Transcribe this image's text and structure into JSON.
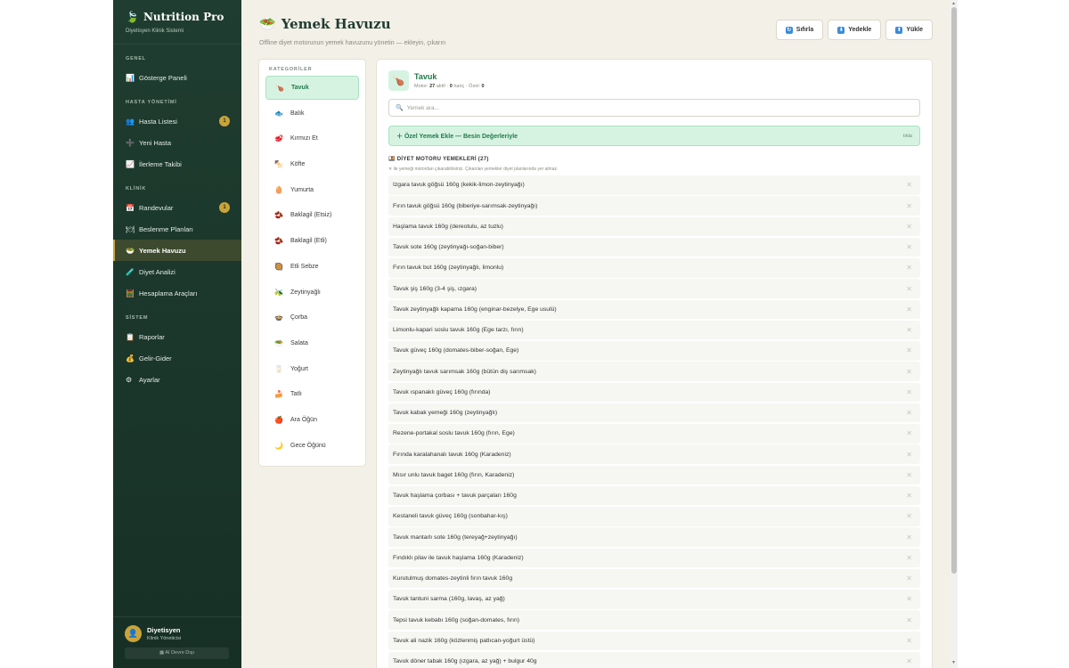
{
  "sidebar": {
    "brand_icon": "🍃",
    "title": "Nutrition Pro",
    "subtitle": "Diyetisyen Klinik Sistemi",
    "sections": [
      {
        "label": "GENEL",
        "items": [
          {
            "icon": "📊",
            "label": "Gösterge Paneli"
          }
        ]
      },
      {
        "label": "HASTA YÖNETİMİ",
        "items": [
          {
            "icon": "👥",
            "label": "Hasta Listesi",
            "badge": "1"
          },
          {
            "icon": "➕",
            "label": "Yeni Hasta"
          },
          {
            "icon": "📈",
            "label": "İlerleme Takibi"
          }
        ]
      },
      {
        "label": "KLİNİK",
        "items": [
          {
            "icon": "📅",
            "label": "Randevular",
            "badge": "1"
          },
          {
            "icon": "🍽",
            "label": "Beslenme Planları"
          },
          {
            "icon": "🥗",
            "label": "Yemek Havuzu",
            "active": true
          },
          {
            "icon": "🧪",
            "label": "Diyet Analizi"
          },
          {
            "icon": "🧮",
            "label": "Hesaplama Araçları"
          }
        ]
      },
      {
        "label": "SİSTEM",
        "items": [
          {
            "icon": "📋",
            "label": "Raporlar"
          },
          {
            "icon": "💰",
            "label": "Gelir-Gider"
          },
          {
            "icon": "⚙",
            "label": "Ayarlar"
          }
        ]
      }
    ],
    "user": {
      "name": "Diyetisyen",
      "role": "Klinik Yöneticisi",
      "ai_button": "AI Devre Dışı"
    }
  },
  "header": {
    "icon": "🥗",
    "title": "Yemek Havuzu",
    "subtitle": "Offline diyet motorunun yemek havuzunu yönetin — ekleyin, çıkarın",
    "buttons": [
      {
        "icon": "↻",
        "label": "Sıfırla"
      },
      {
        "icon": "⬇",
        "label": "Yedekle"
      },
      {
        "icon": "⬆",
        "label": "Yükle"
      }
    ]
  },
  "categories": {
    "title": "KATEGORİLER",
    "items": [
      {
        "icon": "🍗",
        "label": "Tavuk",
        "active": true
      },
      {
        "icon": "🐟",
        "label": "Balık"
      },
      {
        "icon": "🥩",
        "label": "Kırmızı Et"
      },
      {
        "icon": "🍢",
        "label": "Köfte"
      },
      {
        "icon": "🥚",
        "label": "Yumurta"
      },
      {
        "icon": "🫘",
        "label": "Baklagil (Etsiz)"
      },
      {
        "icon": "🫘",
        "label": "Baklagil (Etli)"
      },
      {
        "icon": "🥘",
        "label": "Etli Sebze"
      },
      {
        "icon": "🫒",
        "label": "Zeytinyağlı"
      },
      {
        "icon": "🍲",
        "label": "Çorba"
      },
      {
        "icon": "🥗",
        "label": "Salata"
      },
      {
        "icon": "🥛",
        "label": "Yoğurt"
      },
      {
        "icon": "🍰",
        "label": "Tatlı"
      },
      {
        "icon": "🍎",
        "label": "Ara Öğün"
      },
      {
        "icon": "🌙",
        "label": "Gece Öğünü"
      }
    ]
  },
  "main": {
    "icon": "🍗",
    "title": "Tavuk",
    "stats_prefix": "Motor:",
    "stats_active": "27",
    "stats_active_label": "aktif ·",
    "stats_excluded": "0",
    "stats_excluded_label": "hariç · Özel:",
    "stats_custom": "0",
    "search_placeholder": "Yemek ara...",
    "add_label": "Özel Yemek Ekle — Besin Değerleriyle",
    "add_hint": "tıkla",
    "motor_title": "DİYET MOTORU YEMEKLERİ (27)",
    "motor_note": "✕ ile yemeği motordan çıkarabilirsiniz. Çıkarılan yemekler diyet planlarında yer almaz.",
    "meals": [
      "Izgara tavuk göğsü 160g (kekik-limon-zeytinyağı)",
      "Fırın tavuk göğsü 160g (biberiye-sarımsak-zeytinyağı)",
      "Haşlama tavuk 160g (dereotulu, az tuzlu)",
      "Tavuk sote 160g (zeytinyağı-soğan-biber)",
      "Fırın tavuk but 160g (zeytinyağlı, limonlu)",
      "Tavuk şiş 160g (3-4 şiş, ızgara)",
      "Tavuk zeytinyağlı kapama 160g (enginar-bezelye, Ege usulü)",
      "Limonlu-kapari soslu tavuk 160g (Ege tarzı, fırın)",
      "Tavuk güveç 160g (domates-biber-soğan, Ege)",
      "Zeytinyağlı tavuk sarımsak 160g (bütün diş sarımsak)",
      "Tavuk ıspanaklı güveç 160g (fırında)",
      "Tavuk kabak yemeği 160g (zeytinyağlı)",
      "Rezene-portakal soslu tavuk 160g (fırın, Ege)",
      "Fırında karalahanalı tavuk 160g (Karadeniz)",
      "Mısır unlu tavuk baget 160g (fırın, Karadeniz)",
      "Tavuk haşlama çorbası + tavuk parçaları 160g",
      "Kestaneli tavuk güveç 160g (sonbahar-kış)",
      "Tavuk mantarlı sote 160g (tereyağ+zeytinyağı)",
      "Fındıklı pilav ile tavuk haşlama 160g (Karadeniz)",
      "Kurutulmuş domates-zeytinli fırın tavuk 160g",
      "Tavuk tantuni sarma (160g, lavaş, az yağ)",
      "Tepsi tavuk kebabı 160g (soğan-domates, fırın)",
      "Tavuk ali nazik 160g (közlenmiş patlıcan-yoğurt üstü)",
      "Tavuk döner tabak 160g (ızgara, az yağ) + bulgur 40g"
    ],
    "remove_icon": "✕"
  },
  "colors": {
    "sidebar_bg": "#1f3d30",
    "accent_gold": "#c9a43a",
    "accent_green": "#1f7a4a",
    "active_cat_bg": "#d6f3e2",
    "page_bg": "#f3f0e8"
  }
}
